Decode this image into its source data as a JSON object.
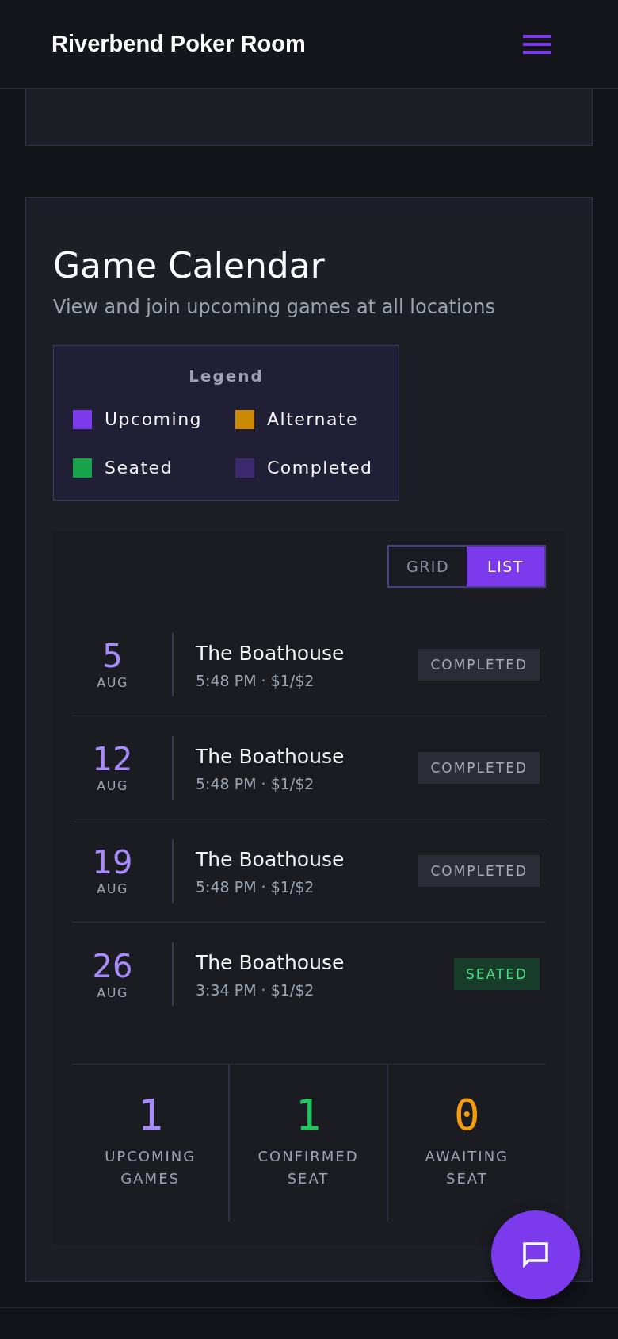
{
  "header": {
    "title": "Riverbend Poker Room"
  },
  "calendar": {
    "title": "Game Calendar",
    "subtitle": "View and join upcoming games at all locations",
    "legend": {
      "title": "Legend",
      "items": [
        {
          "label": "Upcoming",
          "color": "#7c3aed"
        },
        {
          "label": "Alternate",
          "color": "#ca8a04"
        },
        {
          "label": "Seated",
          "color": "#16a34a"
        },
        {
          "label": "Completed",
          "color": "#3b2a6e"
        }
      ]
    },
    "view_toggle": [
      {
        "label": "GRID",
        "selected": false
      },
      {
        "label": "LIST",
        "selected": true
      }
    ],
    "games": [
      {
        "day": "5",
        "month": "AUG",
        "venue": "The Boathouse",
        "details": "5:48 PM · $1/$2",
        "status": "COMPLETED",
        "kind": "completed"
      },
      {
        "day": "12",
        "month": "AUG",
        "venue": "The Boathouse",
        "details": "5:48 PM · $1/$2",
        "status": "COMPLETED",
        "kind": "completed"
      },
      {
        "day": "19",
        "month": "AUG",
        "venue": "The Boathouse",
        "details": "5:48 PM · $1/$2",
        "status": "COMPLETED",
        "kind": "completed"
      },
      {
        "day": "26",
        "month": "AUG",
        "venue": "The Boathouse",
        "details": "3:34 PM · $1/$2",
        "status": "SEATED",
        "kind": "seated"
      }
    ],
    "stats": [
      {
        "value": "1",
        "label": "UPCOMING GAMES",
        "color": "#a78bfa"
      },
      {
        "value": "1",
        "label": "CONFIRMED SEAT",
        "color": "#22c55e"
      },
      {
        "value": "0",
        "label": "AWAITING SEAT",
        "color": "#f59e0b"
      }
    ]
  }
}
